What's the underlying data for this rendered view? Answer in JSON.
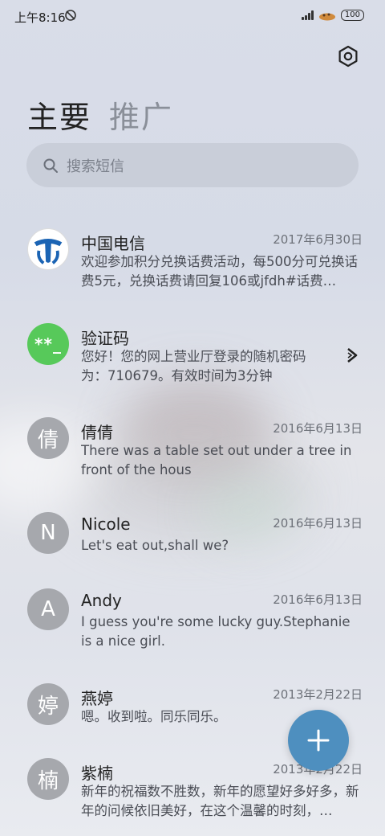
{
  "status_bar": {
    "time": "上午8:16",
    "battery": "100"
  },
  "tabs": [
    {
      "label": "主要",
      "active": true
    },
    {
      "label": "推广",
      "active": false
    }
  ],
  "search": {
    "placeholder": "搜索短信"
  },
  "conversations": [
    {
      "name": "中国电信",
      "date": "2017年6月30日",
      "preview": "欢迎参加积分兑换话费活动，每500分可兑换话费5元，兑换话费请回复106或jfdh#话费…",
      "avatar": "telecom-logo"
    },
    {
      "name": "验证码",
      "date": "",
      "preview": "您好！您的网上营业厅登录的随机密码为：710679。有效时间为3分钟",
      "avatar_text": "**_",
      "avatar_color": "#57c95a"
    },
    {
      "name": "倩倩",
      "date": "2016年6月13日",
      "preview": "There was a table set out under a tree in front of the hous",
      "avatar_text": "倩"
    },
    {
      "name": "Nicole",
      "date": "2016年6月13日",
      "preview": "Let's eat out,shall we?",
      "avatar_text": "N"
    },
    {
      "name": "Andy",
      "date": "2016年6月13日",
      "preview": "I guess you're some lucky guy.Stephanie is a nice girl.",
      "avatar_text": "A"
    },
    {
      "name": "燕婷",
      "date": "2013年2月22日",
      "preview": "嗯。收到啦。同乐同乐。",
      "avatar_text": "婷"
    },
    {
      "name": "紫楠",
      "date": "2013年2月22日",
      "preview": "新年的祝福数不胜数，新年的愿望好多好多，新年的问候依旧美好，在这个温馨的时刻，…",
      "avatar_text": "楠"
    }
  ],
  "colors": {
    "fab": "#4e8fbf",
    "active_tab": "#222222",
    "inactive_tab": "#8a8f99"
  }
}
